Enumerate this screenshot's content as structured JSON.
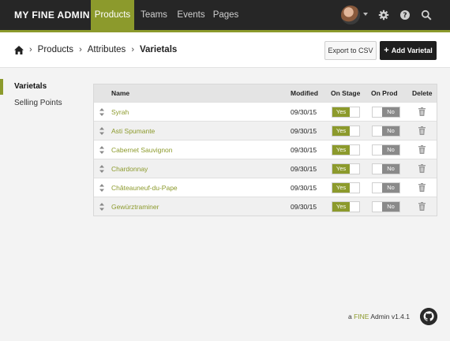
{
  "brand": "MY FINE ADMIN",
  "nav": {
    "items": [
      {
        "label": "Products",
        "active": true
      },
      {
        "label": "Teams",
        "active": false
      },
      {
        "label": "Events",
        "active": false
      },
      {
        "label": "Pages",
        "active": false
      }
    ],
    "icons": [
      "avatar",
      "gear-icon",
      "help-icon",
      "search-icon"
    ]
  },
  "breadcrumb": {
    "items": [
      "Products",
      "Attributes"
    ],
    "current": "Varietals"
  },
  "actions": {
    "export_label": "Export to CSV",
    "add_label": "Add Varietal"
  },
  "sidebar": {
    "items": [
      {
        "label": "Varietals",
        "active": true
      },
      {
        "label": "Selling Points",
        "active": false
      }
    ]
  },
  "table": {
    "columns": [
      "Name",
      "Modified",
      "On Stage",
      "On Prod",
      "Delete"
    ],
    "yes_label": "Yes",
    "no_label": "No",
    "rows": [
      {
        "name": "Syrah",
        "modified": "09/30/15",
        "on_stage": true,
        "on_prod": false
      },
      {
        "name": "Asti Spumante",
        "modified": "09/30/15",
        "on_stage": true,
        "on_prod": false
      },
      {
        "name": "Cabernet Sauvignon",
        "modified": "09/30/15",
        "on_stage": true,
        "on_prod": false
      },
      {
        "name": "Chardonnay",
        "modified": "09/30/15",
        "on_stage": true,
        "on_prod": false
      },
      {
        "name": "Châteauneuf-du-Pape",
        "modified": "09/30/15",
        "on_stage": true,
        "on_prod": false
      },
      {
        "name": "Gewürztraminer",
        "modified": "09/30/15",
        "on_stage": true,
        "on_prod": false
      }
    ]
  },
  "footer": {
    "prefix": "a",
    "fine": "FINE",
    "suffix": "Admin v1.4.1"
  },
  "colors": {
    "accent": "#8c9a2c",
    "topbar": "#262626",
    "toggle_off": "#8a8a8a"
  }
}
